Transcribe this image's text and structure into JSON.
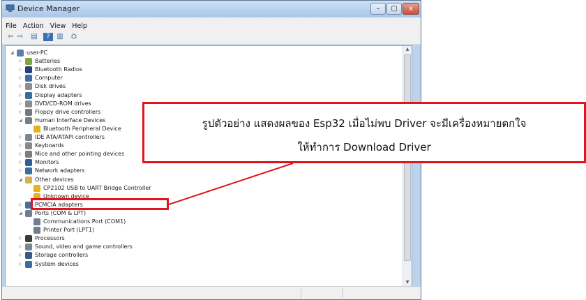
{
  "window": {
    "title": "Device Manager",
    "controls": {
      "minimize": "–",
      "maximize": "▢",
      "close": "x"
    }
  },
  "menu": [
    "File",
    "Action",
    "View",
    "Help"
  ],
  "toolbar": {
    "back": "⇦",
    "forward": "⇨",
    "properties": "▤",
    "help": "?",
    "update": "▥",
    "scan": "⛭"
  },
  "tree": [
    {
      "label": "user-PC",
      "icon": "computer-icon",
      "color": "#5b7fa8",
      "expander": "◢"
    },
    {
      "label": "Batteries",
      "icon": "battery-icon",
      "color": "#7ca63a",
      "expander": "▷"
    },
    {
      "label": "Bluetooth Radios",
      "icon": "bluetooth-icon",
      "color": "#2a3e7a",
      "expander": "▷"
    },
    {
      "label": "Computer",
      "icon": "monitor-icon",
      "color": "#3f6ea6",
      "expander": "▷"
    },
    {
      "label": "Disk drives",
      "icon": "disk-icon",
      "color": "#8e8e8e",
      "expander": "▷"
    },
    {
      "label": "Display adapters",
      "icon": "display-adapter-icon",
      "color": "#3c6d9a",
      "expander": "▷"
    },
    {
      "label": "DVD/CD-ROM drives",
      "icon": "dvd-icon",
      "color": "#8c8c8c",
      "expander": "▷"
    },
    {
      "label": "Floppy drive controllers",
      "icon": "floppy-icon",
      "color": "#6d7a86",
      "expander": "▷"
    },
    {
      "label": "Human Interface Devices",
      "icon": "hid-icon",
      "color": "#6f7f8f",
      "expander": "◢"
    },
    {
      "label": "Bluetooth Peripheral Device",
      "icon": "warning-device-icon",
      "color": "#e3b21c",
      "expander": ""
    },
    {
      "label": "IDE ATA/ATAPI controllers",
      "icon": "ide-icon",
      "color": "#7b8893",
      "expander": "▷"
    },
    {
      "label": "Keyboards",
      "icon": "keyboard-icon",
      "color": "#8a8a8a",
      "expander": "▷"
    },
    {
      "label": "Mice and other pointing devices",
      "icon": "mouse-icon",
      "color": "#7d7d7d",
      "expander": "▷"
    },
    {
      "label": "Monitors",
      "icon": "monitor-icon",
      "color": "#2f5f95",
      "expander": "▷"
    },
    {
      "label": "Network adapters",
      "icon": "network-icon",
      "color": "#3a6ea3",
      "expander": "▷"
    },
    {
      "label": "Other devices",
      "icon": "other-devices-icon",
      "color": "#d4b24a",
      "expander": "◢"
    },
    {
      "label": "CP2102 USB to UART Bridge Controller",
      "icon": "warning-device-icon",
      "color": "#e3b21c",
      "expander": ""
    },
    {
      "label": "Unknown device",
      "icon": "warning-device-icon",
      "color": "#e3b21c",
      "expander": ""
    },
    {
      "label": "PCMCIA adapters",
      "icon": "pcmcia-icon",
      "color": "#4a6f95",
      "expander": "▷"
    },
    {
      "label": "Ports (COM & LPT)",
      "icon": "port-icon",
      "color": "#6f7f8f",
      "expander": "◢"
    },
    {
      "label": "Communications Port (COM1)",
      "icon": "port-icon",
      "color": "#6f7f8f",
      "expander": ""
    },
    {
      "label": "Printer Port (LPT1)",
      "icon": "port-icon",
      "color": "#6f7f8f",
      "expander": ""
    },
    {
      "label": "Processors",
      "icon": "processor-icon",
      "color": "#3b3b3b",
      "expander": "▷"
    },
    {
      "label": "Sound, video and game controllers",
      "icon": "speaker-icon",
      "color": "#7b8591",
      "expander": "▷"
    },
    {
      "label": "Storage controllers",
      "icon": "storage-icon",
      "color": "#3a5b83",
      "expander": "▷"
    },
    {
      "label": "System devices",
      "icon": "system-icon",
      "color": "#3c6ca0",
      "expander": "▷"
    }
  ],
  "annotation": {
    "line1": "รูปตัวอย่าง แสดงผลของ Esp32 เมื่อไม่พบ Driver จะมีเครื่องหมายตกใจ",
    "line2": "ให้ทำการ Download Driver",
    "color": "#e0141c"
  }
}
